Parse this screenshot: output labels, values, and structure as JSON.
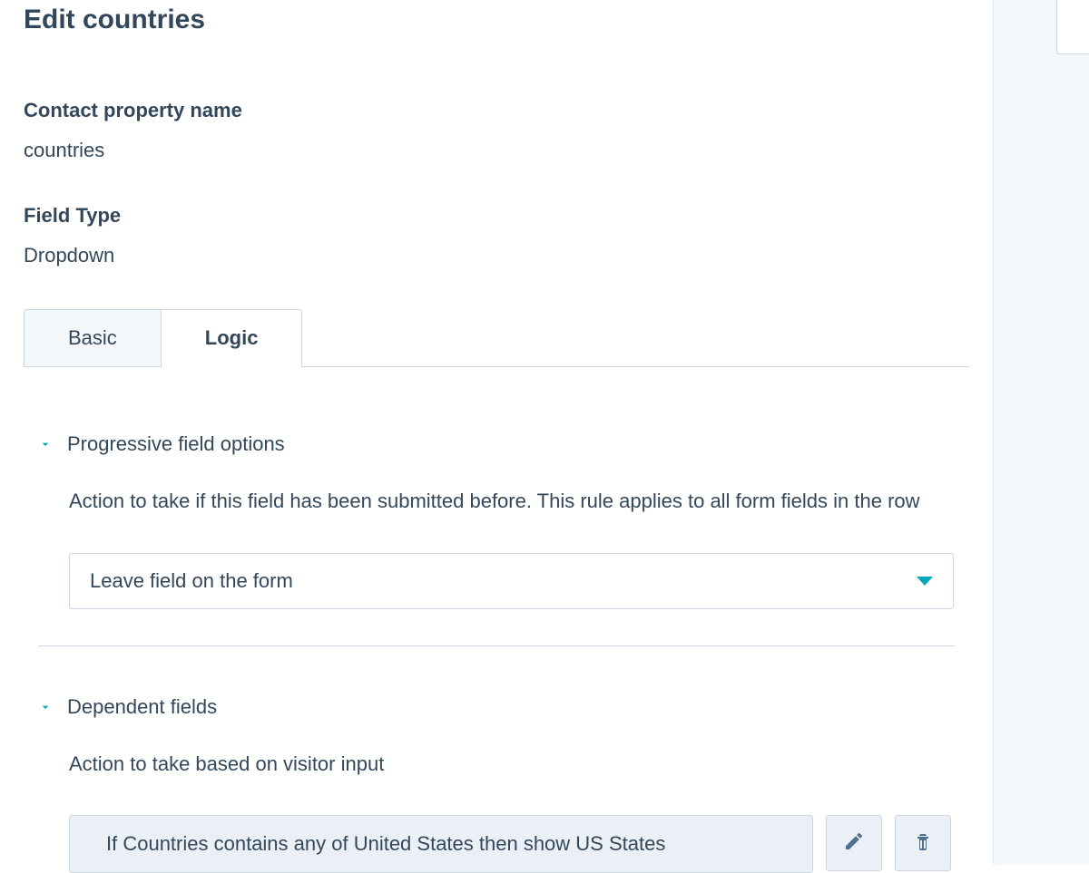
{
  "page": {
    "title": "Edit countries"
  },
  "contactProperty": {
    "label": "Contact property name",
    "value": "countries"
  },
  "fieldType": {
    "label": "Field Type",
    "value": "Dropdown"
  },
  "tabs": {
    "basic": "Basic",
    "logic": "Logic"
  },
  "progressive": {
    "title": "Progressive field options",
    "description": "Action to take if this field has been submitted before. This rule applies to all form fields in the row",
    "selected": "Leave field on the form"
  },
  "dependent": {
    "title": "Dependent fields",
    "description": "Action to take based on visitor input",
    "rule": "If Countries contains any of United States then show US States"
  },
  "colors": {
    "accent": "#00a4bd",
    "text": "#33475b",
    "border": "#cbd6e2",
    "panelBg": "#f5f8fa",
    "ruleBg": "#eaf0f6",
    "iconFill": "#516f90"
  }
}
